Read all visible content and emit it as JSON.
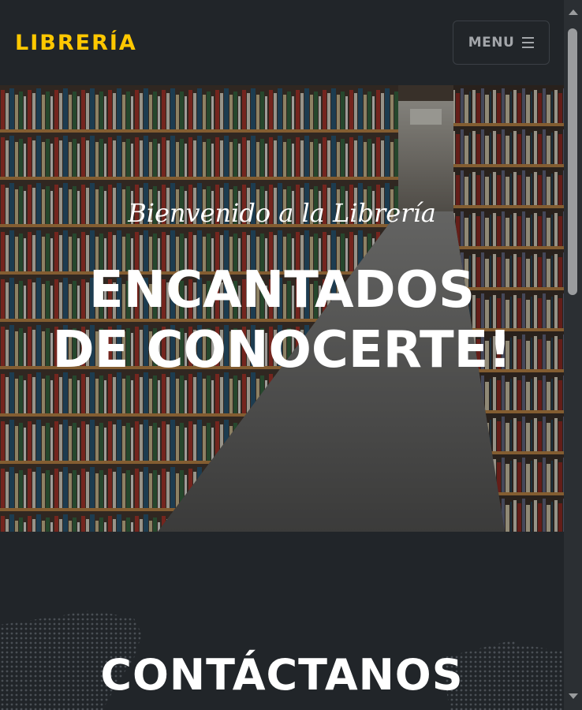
{
  "navbar": {
    "brand": "LIBRERÍA",
    "menu_label": "MENU",
    "menu_icon": "hamburger-icon"
  },
  "hero": {
    "subheading": "Bienvenido a la Librería",
    "heading_line1": "ENCANTADOS",
    "heading_line2": "DE CONOCERTE!",
    "background": "bookstore-aisle-photo"
  },
  "contact": {
    "heading": "CONTÁCTANOS",
    "background": "dotted-world-map"
  },
  "colors": {
    "brand": "#ffc800",
    "background": "#212529",
    "text": "#ffffff"
  }
}
